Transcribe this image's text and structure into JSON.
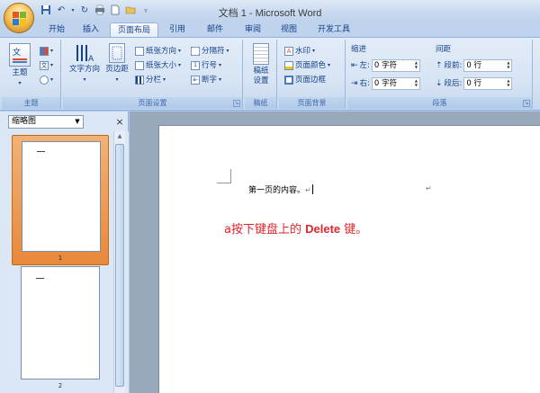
{
  "window": {
    "title": "文档 1 - Microsoft Word"
  },
  "qat": {
    "icons": [
      "save-icon",
      "undo-icon",
      "redo-icon",
      "print-icon",
      "new-doc-icon",
      "open-icon",
      "customize-icon"
    ]
  },
  "tabs": [
    {
      "label": "开始",
      "active": false
    },
    {
      "label": "插入",
      "active": false
    },
    {
      "label": "页面布局",
      "active": true
    },
    {
      "label": "引用",
      "active": false
    },
    {
      "label": "邮件",
      "active": false
    },
    {
      "label": "审阅",
      "active": false
    },
    {
      "label": "视图",
      "active": false
    },
    {
      "label": "开发工具",
      "active": false
    }
  ],
  "ribbon": {
    "themes": {
      "group_label": "主题",
      "theme_button": "主题"
    },
    "page_setup": {
      "group_label": "页面设置",
      "text_direction": "文字方向",
      "margins": "页边距",
      "orientation": "纸张方向",
      "size": "纸张大小",
      "columns": "分栏",
      "breaks": "分隔符",
      "line_numbers": "行号",
      "hyphenation": "断字"
    },
    "draft_paper": {
      "group_label": "稿纸",
      "button_line1": "稿纸",
      "button_line2": "设置"
    },
    "page_background": {
      "group_label": "页面背景",
      "watermark": "水印",
      "page_color": "页面颜色",
      "page_borders": "页面边框"
    },
    "paragraph": {
      "group_label": "段落",
      "indent_title": "缩进",
      "spacing_title": "间距",
      "indent_left_label": "左:",
      "indent_left_value": "0 字符",
      "indent_right_label": "右:",
      "indent_right_value": "0 字符",
      "spacing_before_label": "段前:",
      "spacing_before_value": "0 行",
      "spacing_after_label": "段后:",
      "spacing_after_value": "0 行"
    }
  },
  "nav_pane": {
    "view_select": "缩略图",
    "close": "×",
    "thumbnails": [
      {
        "page": "1",
        "selected": true
      },
      {
        "page": "2",
        "selected": false
      }
    ]
  },
  "document": {
    "line1": "第一页的内容。",
    "instruction_prefix": "a按下键盘上的 ",
    "instruction_key": "Delete",
    "instruction_suffix": " 键。"
  },
  "colors": {
    "accent": "#15428b",
    "selected_thumb": "#e8883a",
    "instruction_red": "#e0262b"
  }
}
